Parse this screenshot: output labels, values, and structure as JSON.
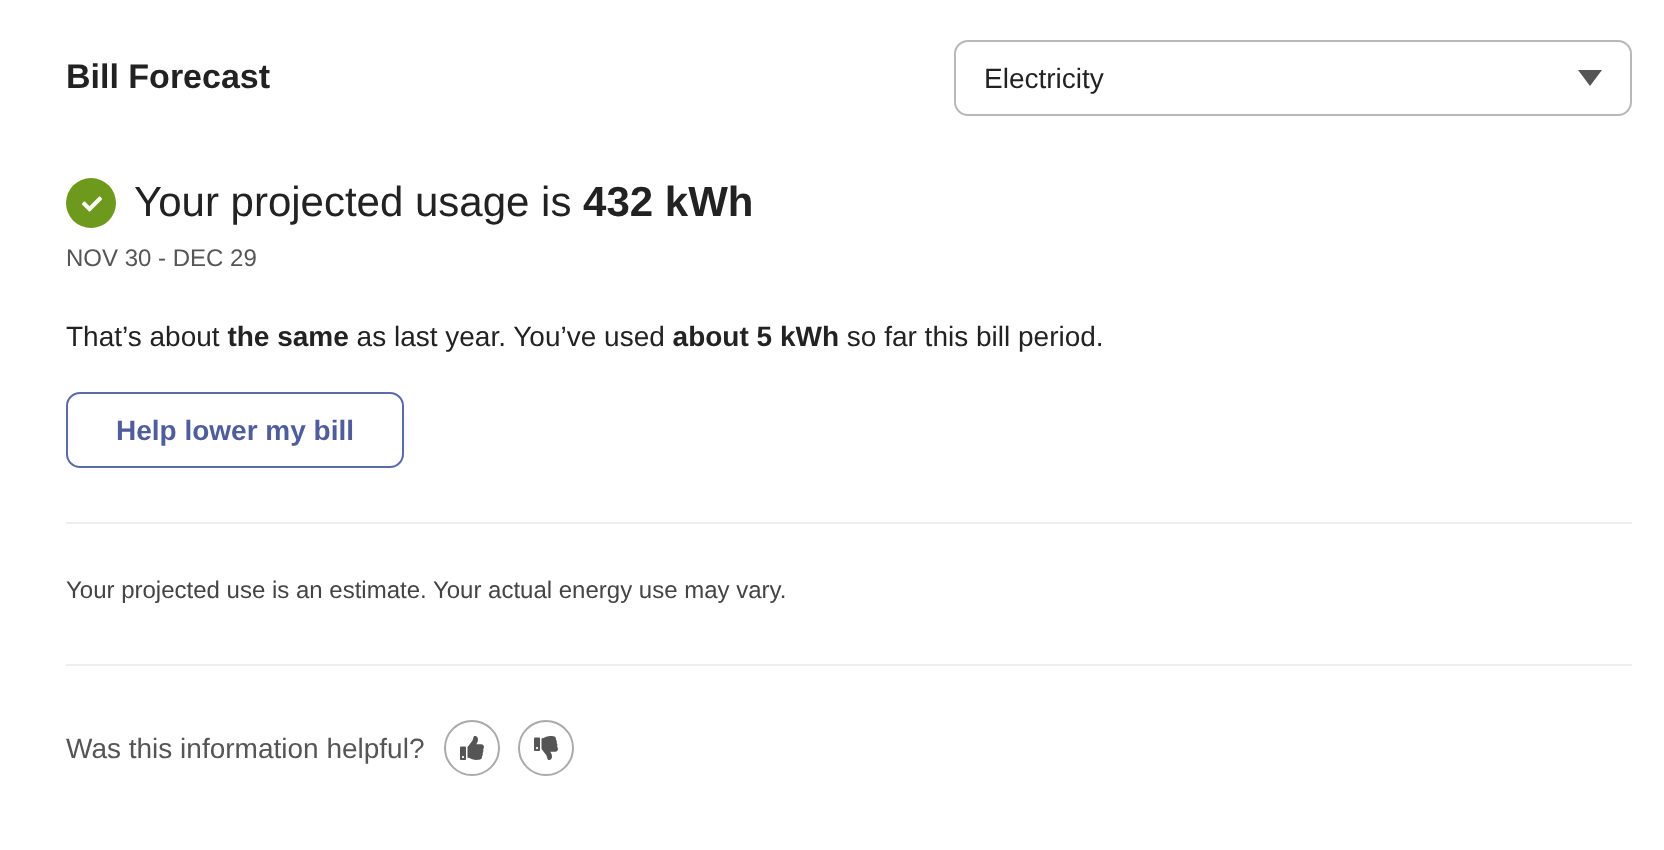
{
  "title": "Bill Forecast",
  "fuel_select": {
    "value": "Electricity"
  },
  "headline": "Your projected usage is **432 kWh**",
  "period": "NOV 30 - DEC 29",
  "summary": "That’s about **the same** as last year. You’ve used **about 5 kWh** so far this bill period.",
  "action_button": "Help lower my bill",
  "disclaimer": "Your projected use is an estimate. Your actual energy use may vary.",
  "feedback": {
    "question": "Was this information helpful?"
  }
}
